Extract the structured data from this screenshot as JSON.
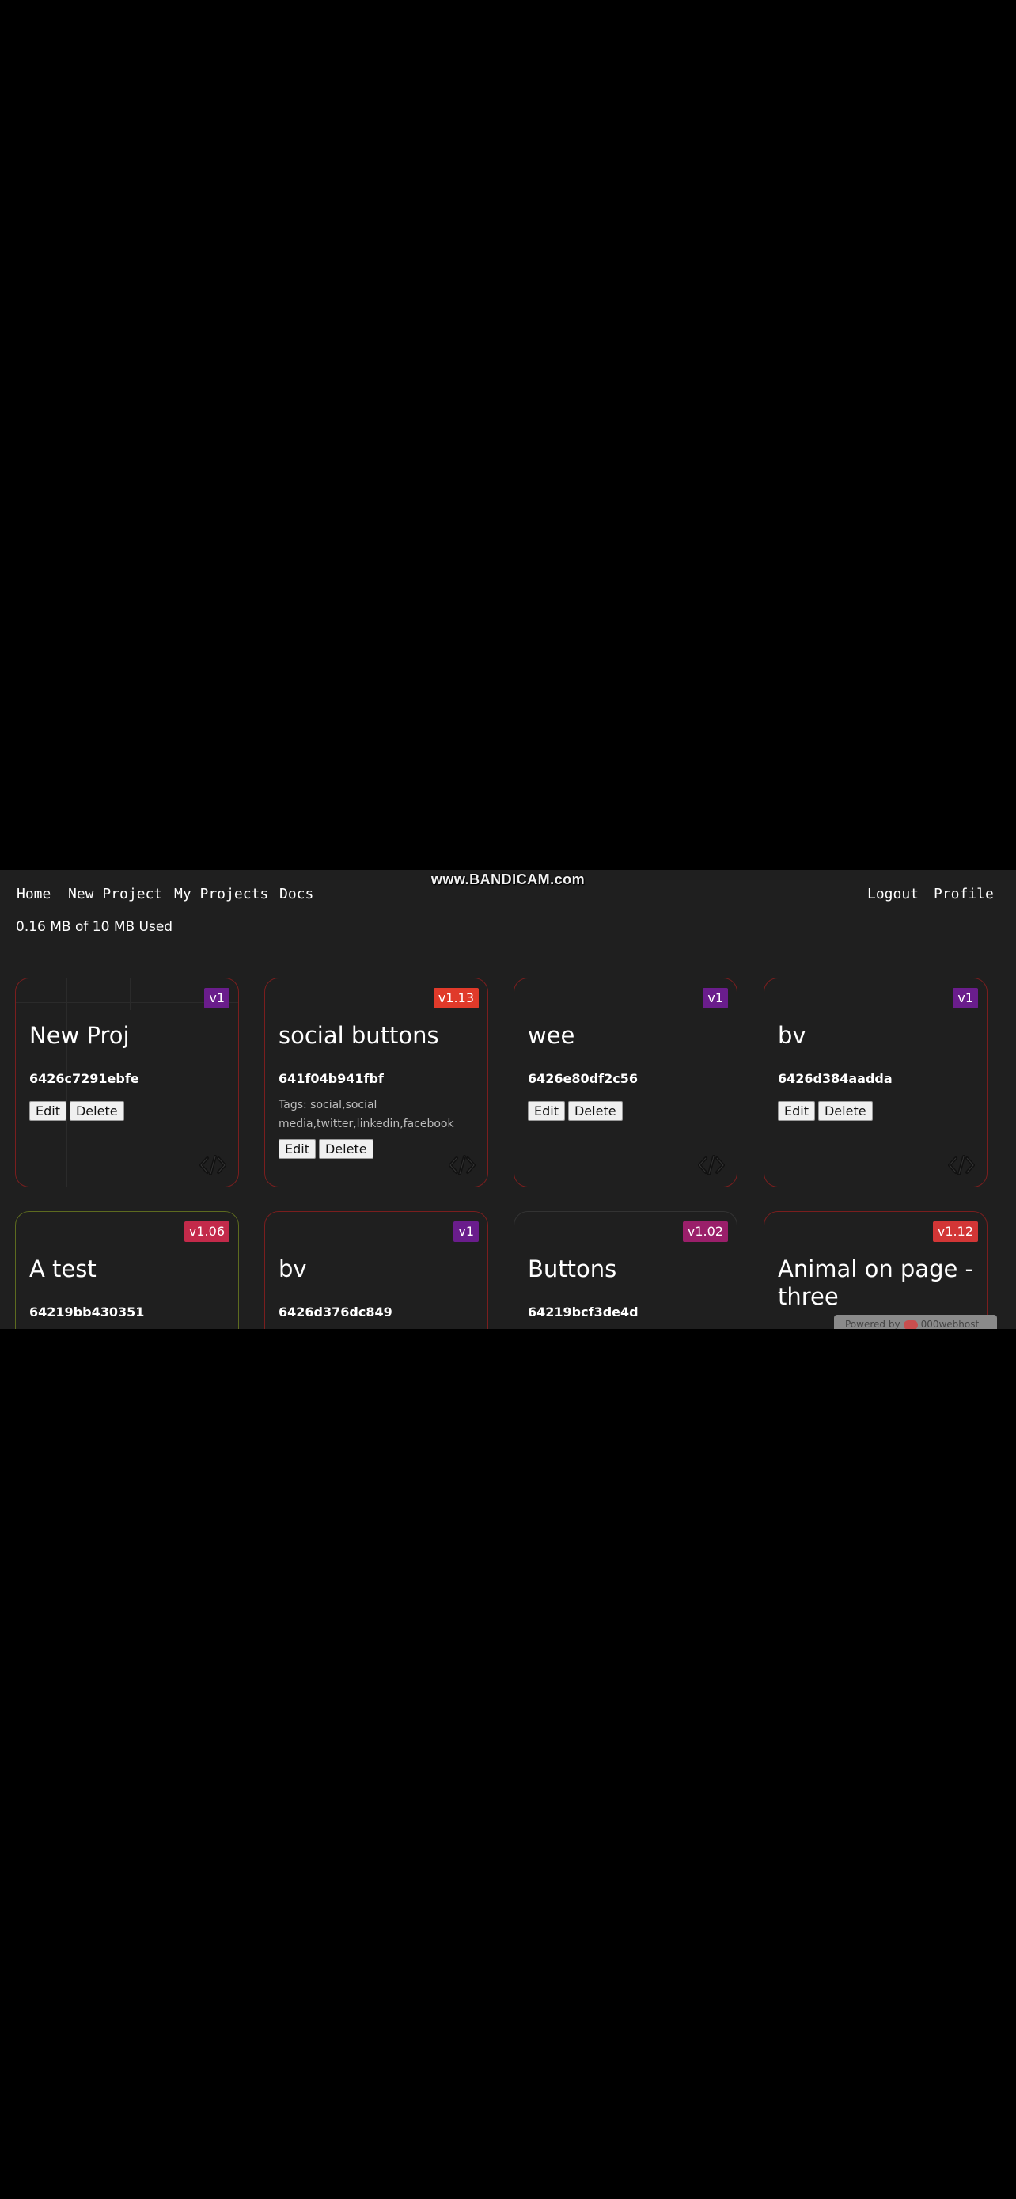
{
  "watermark": "www.BANDICAM.com",
  "nav": {
    "home": "Home",
    "new_project": "New Project",
    "my_projects": "My Projects",
    "docs": "Docs",
    "logout": "Logout",
    "profile": "Profile"
  },
  "usage": "0.16 MB of 10 MB Used",
  "buttons": {
    "edit": "Edit",
    "delete": "Delete"
  },
  "icons": {
    "code": "code-icon"
  },
  "projects": [
    {
      "title": "New Proj",
      "id": "6426c7291ebfe",
      "version": "v1",
      "badge_color": "#6a1d8c"
    },
    {
      "title": "social buttons",
      "id": "641f04b941fbf",
      "version": "v1.13",
      "badge_color": "#e03a2a",
      "tags": "Tags: social,social media,twitter,linkedin,facebook"
    },
    {
      "title": "wee",
      "id": "6426e80df2c56",
      "version": "v1",
      "badge_color": "#6a1d8c"
    },
    {
      "title": "bv",
      "id": "6426d384aadda",
      "version": "v1",
      "badge_color": "#6a1d8c"
    },
    {
      "title": "A test",
      "id": "64219bb430351",
      "version": "v1.06",
      "badge_color": "#c32a4a"
    },
    {
      "title": "bv",
      "id": "6426d376dc849",
      "version": "v1",
      "badge_color": "#6a1d8c"
    },
    {
      "title": "Buttons",
      "id": "64219bcf3de4d",
      "version": "v1.02",
      "badge_color": "#9a1f6a"
    },
    {
      "title": "Animal on page - three",
      "version": "v1.12",
      "badge_color": "#d23636"
    }
  ],
  "powered": {
    "text": "Powered by",
    "brand": "000webhost"
  }
}
